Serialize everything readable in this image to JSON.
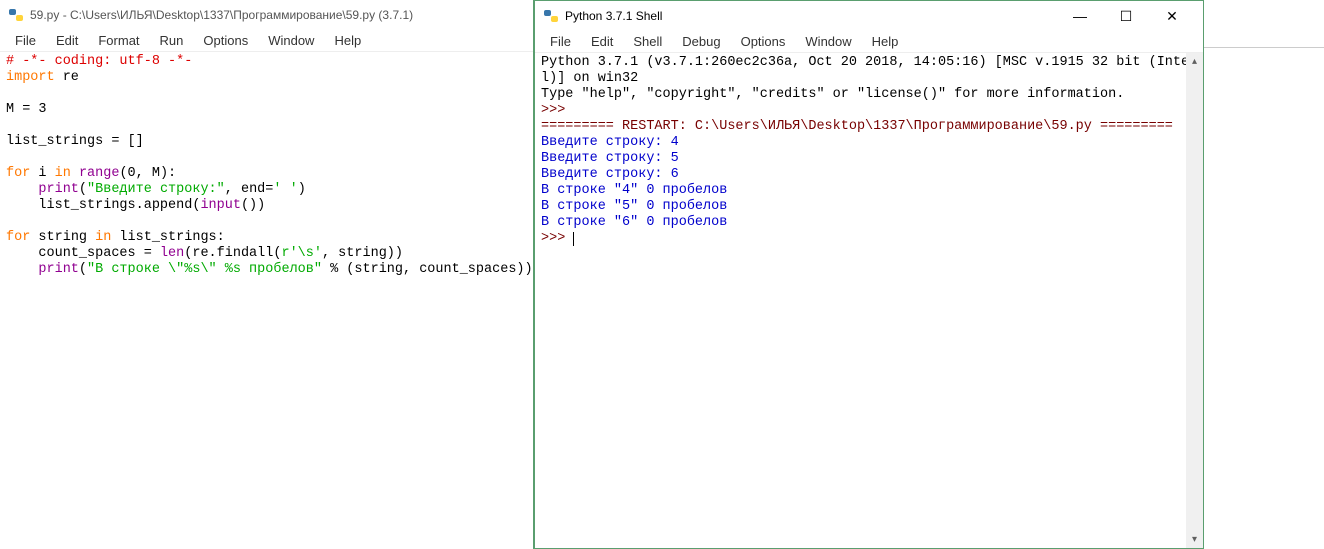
{
  "editor": {
    "title": "59.py - C:\\Users\\ИЛЬЯ\\Desktop\\1337\\Программирование\\59.py (3.7.1)",
    "menu": [
      "File",
      "Edit",
      "Format",
      "Run",
      "Options",
      "Window",
      "Help"
    ],
    "code": [
      {
        "cls": "c-comment",
        "text": "# -*- coding: utf-8 -*-"
      },
      [
        {
          "cls": "c-keyword",
          "text": "import"
        },
        {
          "cls": "c-plain",
          "text": " re"
        }
      ],
      {
        "cls": "c-plain",
        "text": ""
      },
      {
        "cls": "c-plain",
        "text": "M = 3"
      },
      {
        "cls": "c-plain",
        "text": ""
      },
      {
        "cls": "c-plain",
        "text": "list_strings = []"
      },
      {
        "cls": "c-plain",
        "text": ""
      },
      [
        {
          "cls": "c-keyword",
          "text": "for"
        },
        {
          "cls": "c-plain",
          "text": " i "
        },
        {
          "cls": "c-keyword",
          "text": "in"
        },
        {
          "cls": "c-plain",
          "text": " "
        },
        {
          "cls": "c-builtin",
          "text": "range"
        },
        {
          "cls": "c-plain",
          "text": "(0, M):"
        }
      ],
      [
        {
          "cls": "c-plain",
          "text": "    "
        },
        {
          "cls": "c-builtin",
          "text": "print"
        },
        {
          "cls": "c-plain",
          "text": "("
        },
        {
          "cls": "c-string",
          "text": "\"Введите строку:\""
        },
        {
          "cls": "c-plain",
          "text": ", end="
        },
        {
          "cls": "c-string",
          "text": "' '"
        },
        {
          "cls": "c-plain",
          "text": ")"
        }
      ],
      [
        {
          "cls": "c-plain",
          "text": "    list_strings.append("
        },
        {
          "cls": "c-builtin",
          "text": "input"
        },
        {
          "cls": "c-plain",
          "text": "())"
        }
      ],
      {
        "cls": "c-plain",
        "text": ""
      },
      [
        {
          "cls": "c-keyword",
          "text": "for"
        },
        {
          "cls": "c-plain",
          "text": " string "
        },
        {
          "cls": "c-keyword",
          "text": "in"
        },
        {
          "cls": "c-plain",
          "text": " list_strings:"
        }
      ],
      [
        {
          "cls": "c-plain",
          "text": "    count_spaces = "
        },
        {
          "cls": "c-builtin",
          "text": "len"
        },
        {
          "cls": "c-plain",
          "text": "(re.findall("
        },
        {
          "cls": "c-string",
          "text": "r'\\s'"
        },
        {
          "cls": "c-plain",
          "text": ", string))"
        }
      ],
      [
        {
          "cls": "c-plain",
          "text": "    "
        },
        {
          "cls": "c-builtin",
          "text": "print"
        },
        {
          "cls": "c-plain",
          "text": "("
        },
        {
          "cls": "c-string",
          "text": "\"В строке \\\"%s\\\" %s пробелов\""
        },
        {
          "cls": "c-plain",
          "text": " % (string, count_spaces))"
        }
      ]
    ]
  },
  "shell": {
    "title": "Python 3.7.1 Shell",
    "menu": [
      "File",
      "Edit",
      "Shell",
      "Debug",
      "Options",
      "Window",
      "Help"
    ],
    "controls": {
      "min": "—",
      "max": "☐",
      "close": "✕"
    },
    "lines": [
      {
        "cls": "c-plain",
        "text": "Python 3.7.1 (v3.7.1:260ec2c36a, Oct 20 2018, 14:05:16) [MSC v.1915 32 bit (Inte"
      },
      {
        "cls": "c-plain",
        "text": "l)] on win32"
      },
      {
        "cls": "c-plain",
        "text": "Type \"help\", \"copyright\", \"credits\" or \"license()\" for more information."
      },
      {
        "cls": "c-prompt",
        "text": ">>> "
      },
      {
        "cls": "c-prompt",
        "text": "========= RESTART: C:\\Users\\ИЛЬЯ\\Desktop\\1337\\Программирование\\59.py ========="
      },
      {
        "cls": "c-out",
        "text": "Введите строку: 4"
      },
      {
        "cls": "c-out",
        "text": "Введите строку: 5"
      },
      {
        "cls": "c-out",
        "text": "Введите строку: 6"
      },
      {
        "cls": "c-out",
        "text": "В строке \"4\" 0 пробелов"
      },
      {
        "cls": "c-out",
        "text": "В строке \"5\" 0 пробелов"
      },
      {
        "cls": "c-out",
        "text": "В строке \"6\" 0 пробелов"
      },
      {
        "cls": "c-prompt",
        "text": ">>> ",
        "cursor": true
      }
    ]
  }
}
